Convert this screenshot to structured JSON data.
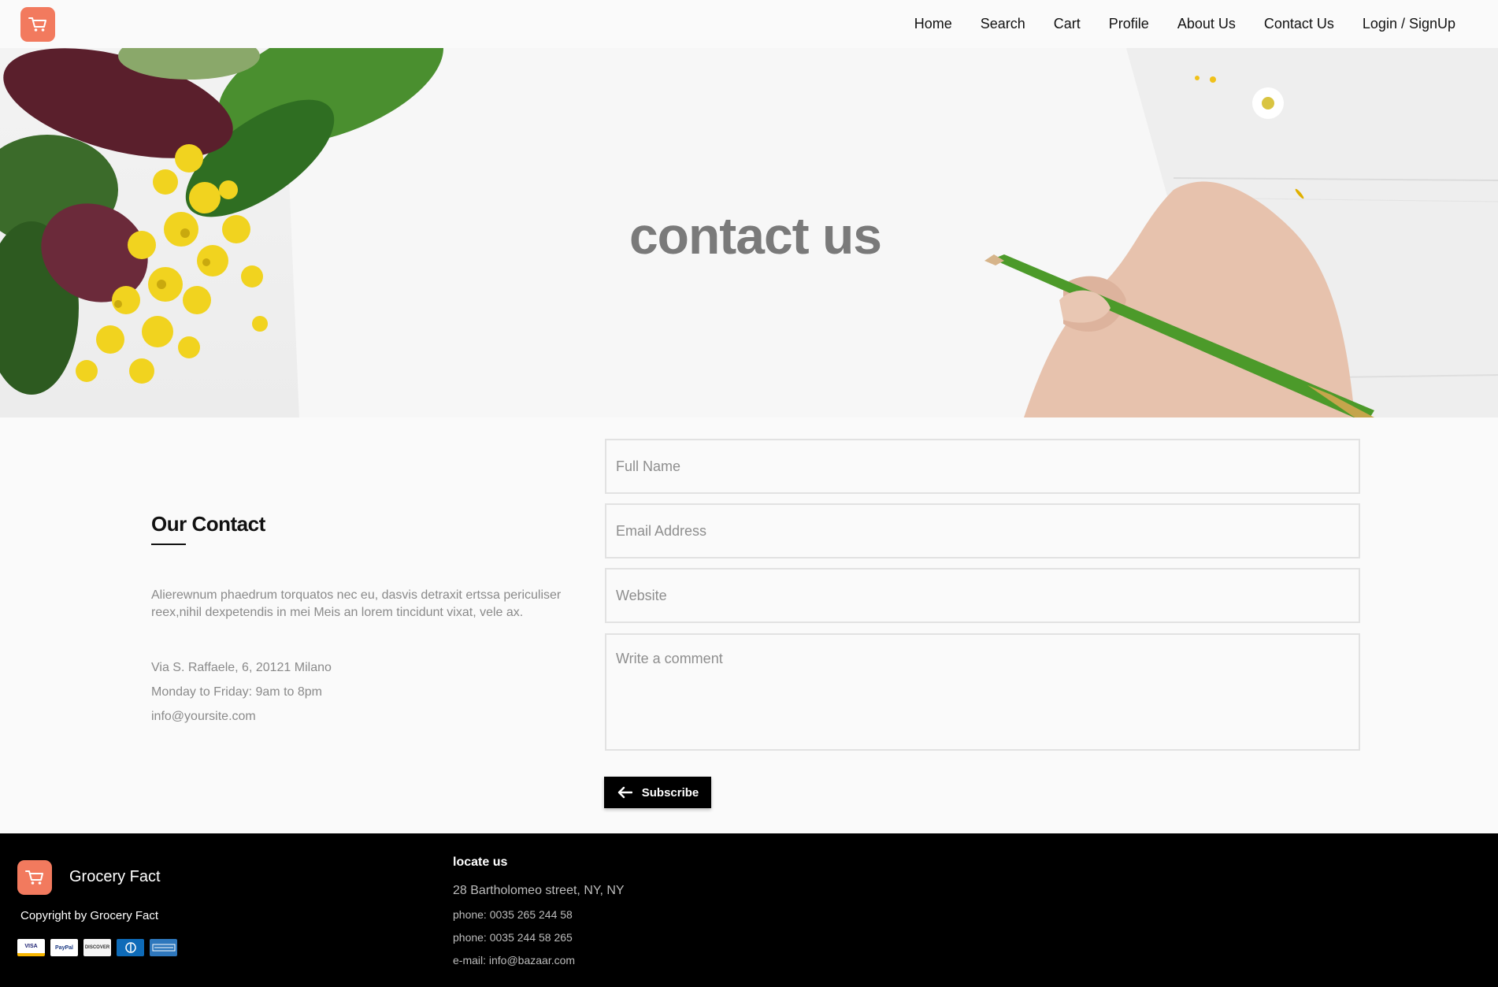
{
  "brand": {
    "name": "Grocery Fact",
    "accent_color": "#f27a5e",
    "logo_icon": "cart-icon"
  },
  "nav": {
    "items": [
      {
        "label": "Home"
      },
      {
        "label": "Search"
      },
      {
        "label": "Cart"
      },
      {
        "label": "Profile"
      },
      {
        "label": "About Us"
      },
      {
        "label": "Contact Us"
      },
      {
        "label": "Login / SignUp"
      }
    ]
  },
  "hero": {
    "title": "contact us"
  },
  "contact": {
    "heading": "Our Contact",
    "description": "Alierewnum phaedrum torquatos nec eu, dasvis detraxit ertssa periculiser reex,nihil dexpetendis in mei Meis an lorem tincidunt vixat, vele ax.",
    "address": "Via S. Raffaele, 6, 20121 Milano",
    "hours": "Monday to Friday: 9am to 8pm",
    "email": "info@yoursite.com"
  },
  "form": {
    "full_name_placeholder": "Full Name",
    "email_placeholder": "Email Address",
    "website_placeholder": "Website",
    "comment_placeholder": "Write a comment",
    "submit_label": "Subscribe",
    "submit_icon": "arrow-left-icon"
  },
  "footer": {
    "brand_name": "Grocery Fact",
    "copyright": "Copyright by Grocery Fact",
    "payment_methods": [
      "VISA",
      "PayPal",
      "DISCOVER",
      "Diners Club",
      "AMERICAN EXPRESS"
    ],
    "locate_title": "locate us",
    "locate_address": "28 Bartholomeo street, NY, NY",
    "phone_1": "phone: 0035 265 244 58",
    "phone_2": "phone: 0035 244 58 265",
    "email": "e-mail: info@bazaar.com"
  }
}
